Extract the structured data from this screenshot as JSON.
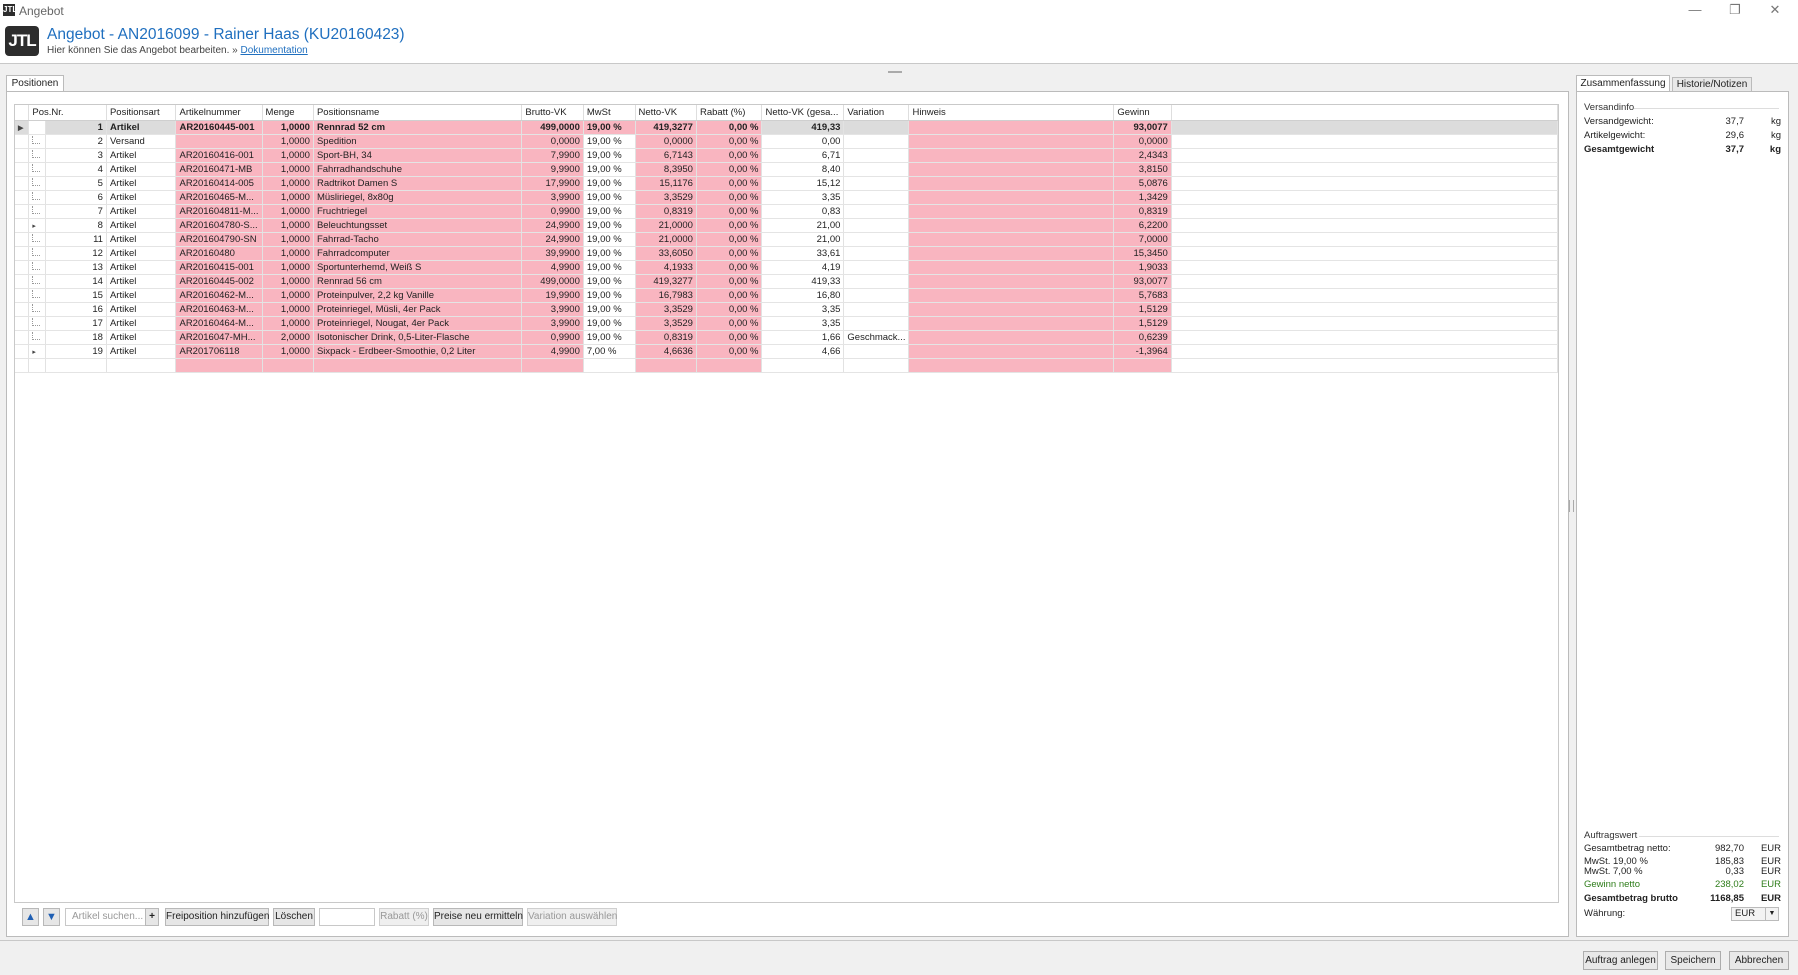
{
  "window": {
    "title": "Angebot",
    "icon": "JTL",
    "minimize": "—",
    "restore": "❐",
    "close": "✕"
  },
  "header": {
    "logo": "JTL",
    "title": "Angebot - AN2016099 - Rainer Haas (KU20160423)",
    "subtitle": "Hier können Sie das Angebot bearbeiten.",
    "separator": "»",
    "doc_link": "Dokumentation"
  },
  "left_tab": "Positionen",
  "columns": [
    "Pos.Nr.",
    "Positionsart",
    "Artikelnummer",
    "Menge",
    "Positionsname",
    "Brutto-VK",
    "MwSt",
    "Netto-VK",
    "Rabatt (%)",
    "Netto-VK (gesa...",
    "Variation",
    "Hinweis",
    "Gewinn"
  ],
  "rows": [
    {
      "pos": "1",
      "art": "Artikel",
      "nr": "AR20160445-001",
      "menge": "1,0000",
      "name": "Rennrad 52 cm",
      "brutto": "499,0000",
      "mwst": "19,00 %",
      "netto": "419,3277",
      "rabatt": "0,00 %",
      "gesamt": "419,33",
      "variation": "",
      "hinweis": "",
      "gewinn": "93,0077",
      "expand": "▸"
    },
    {
      "pos": "2",
      "art": "Versand",
      "nr": "",
      "menge": "1,0000",
      "name": "Spedition",
      "brutto": "0,0000",
      "mwst": "19,00 %",
      "netto": "0,0000",
      "rabatt": "0,00 %",
      "gesamt": "0,00",
      "variation": "",
      "hinweis": "",
      "gewinn": "0,0000",
      "expand": ""
    },
    {
      "pos": "3",
      "art": "Artikel",
      "nr": "AR20160416-001",
      "menge": "1,0000",
      "name": "Sport-BH, 34",
      "brutto": "7,9900",
      "mwst": "19,00 %",
      "netto": "6,7143",
      "rabatt": "0,00 %",
      "gesamt": "6,71",
      "variation": "",
      "hinweis": "",
      "gewinn": "2,4343",
      "expand": ""
    },
    {
      "pos": "4",
      "art": "Artikel",
      "nr": "AR20160471-MB",
      "menge": "1,0000",
      "name": "Fahrradhandschuhe",
      "brutto": "9,9900",
      "mwst": "19,00 %",
      "netto": "8,3950",
      "rabatt": "0,00 %",
      "gesamt": "8,40",
      "variation": "",
      "hinweis": "",
      "gewinn": "3,8150",
      "expand": ""
    },
    {
      "pos": "5",
      "art": "Artikel",
      "nr": "AR20160414-005",
      "menge": "1,0000",
      "name": "Radtrikot Damen S",
      "brutto": "17,9900",
      "mwst": "19,00 %",
      "netto": "15,1176",
      "rabatt": "0,00 %",
      "gesamt": "15,12",
      "variation": "",
      "hinweis": "",
      "gewinn": "5,0876",
      "expand": ""
    },
    {
      "pos": "6",
      "art": "Artikel",
      "nr": "AR20160465-M...",
      "menge": "1,0000",
      "name": "Müsliriegel, 8x80g",
      "brutto": "3,9900",
      "mwst": "19,00 %",
      "netto": "3,3529",
      "rabatt": "0,00 %",
      "gesamt": "3,35",
      "variation": "",
      "hinweis": "",
      "gewinn": "1,3429",
      "expand": ""
    },
    {
      "pos": "7",
      "art": "Artikel",
      "nr": "AR201604811-M...",
      "menge": "1,0000",
      "name": "Fruchtriegel",
      "brutto": "0,9900",
      "mwst": "19,00 %",
      "netto": "0,8319",
      "rabatt": "0,00 %",
      "gesamt": "0,83",
      "variation": "",
      "hinweis": "",
      "gewinn": "0,8319",
      "expand": ""
    },
    {
      "pos": "8",
      "art": "Artikel",
      "nr": "AR201604780-S...",
      "menge": "1,0000",
      "name": "Beleuchtungsset",
      "brutto": "24,9900",
      "mwst": "19,00 %",
      "netto": "21,0000",
      "rabatt": "0,00 %",
      "gesamt": "21,00",
      "variation": "",
      "hinweis": "",
      "gewinn": "6,2200",
      "expand": "▸"
    },
    {
      "pos": "11",
      "art": "Artikel",
      "nr": "AR201604790-SN",
      "menge": "1,0000",
      "name": "Fahrrad-Tacho",
      "brutto": "24,9900",
      "mwst": "19,00 %",
      "netto": "21,0000",
      "rabatt": "0,00 %",
      "gesamt": "21,00",
      "variation": "",
      "hinweis": "",
      "gewinn": "7,0000",
      "expand": ""
    },
    {
      "pos": "12",
      "art": "Artikel",
      "nr": "AR20160480",
      "menge": "1,0000",
      "name": "Fahrradcomputer",
      "brutto": "39,9900",
      "mwst": "19,00 %",
      "netto": "33,6050",
      "rabatt": "0,00 %",
      "gesamt": "33,61",
      "variation": "",
      "hinweis": "",
      "gewinn": "15,3450",
      "expand": ""
    },
    {
      "pos": "13",
      "art": "Artikel",
      "nr": "AR20160415-001",
      "menge": "1,0000",
      "name": "Sportunterhemd, Weiß S",
      "brutto": "4,9900",
      "mwst": "19,00 %",
      "netto": "4,1933",
      "rabatt": "0,00 %",
      "gesamt": "4,19",
      "variation": "",
      "hinweis": "",
      "gewinn": "1,9033",
      "expand": ""
    },
    {
      "pos": "14",
      "art": "Artikel",
      "nr": "AR20160445-002",
      "menge": "1,0000",
      "name": "Rennrad 56 cm",
      "brutto": "499,0000",
      "mwst": "19,00 %",
      "netto": "419,3277",
      "rabatt": "0,00 %",
      "gesamt": "419,33",
      "variation": "",
      "hinweis": "",
      "gewinn": "93,0077",
      "expand": ""
    },
    {
      "pos": "15",
      "art": "Artikel",
      "nr": "AR20160462-M...",
      "menge": "1,0000",
      "name": "Proteinpulver, 2,2 kg Vanille",
      "brutto": "19,9900",
      "mwst": "19,00 %",
      "netto": "16,7983",
      "rabatt": "0,00 %",
      "gesamt": "16,80",
      "variation": "",
      "hinweis": "",
      "gewinn": "5,7683",
      "expand": ""
    },
    {
      "pos": "16",
      "art": "Artikel",
      "nr": "AR20160463-M...",
      "menge": "1,0000",
      "name": "Proteinriegel, Müsli, 4er Pack",
      "brutto": "3,9900",
      "mwst": "19,00 %",
      "netto": "3,3529",
      "rabatt": "0,00 %",
      "gesamt": "3,35",
      "variation": "",
      "hinweis": "",
      "gewinn": "1,5129",
      "expand": ""
    },
    {
      "pos": "17",
      "art": "Artikel",
      "nr": "AR20160464-M...",
      "menge": "1,0000",
      "name": "Proteinriegel, Nougat, 4er Pack",
      "brutto": "3,9900",
      "mwst": "19,00 %",
      "netto": "3,3529",
      "rabatt": "0,00 %",
      "gesamt": "3,35",
      "variation": "",
      "hinweis": "",
      "gewinn": "1,5129",
      "expand": ""
    },
    {
      "pos": "18",
      "art": "Artikel",
      "nr": "AR2016047-MH...",
      "menge": "2,0000",
      "name": "Isotonischer Drink, 0,5-Liter-Flasche",
      "brutto": "0,9900",
      "mwst": "19,00 %",
      "netto": "0,8319",
      "rabatt": "0,00 %",
      "gesamt": "1,66",
      "variation": "Geschmack...",
      "hinweis": "",
      "gewinn": "0,6239",
      "expand": ""
    },
    {
      "pos": "19",
      "art": "Artikel",
      "nr": "AR201706118",
      "menge": "1,0000",
      "name": "Sixpack - Erdbeer-Smoothie, 0,2 Liter",
      "brutto": "4,9900",
      "mwst": "7,00 %",
      "netto": "4,6636",
      "rabatt": "0,00 %",
      "gesamt": "4,66",
      "variation": "",
      "hinweis": "",
      "gewinn": "-1,3964",
      "expand": "▸"
    }
  ],
  "toolbar": {
    "up": "▲",
    "down": "▼",
    "search_placeholder": "Artikel suchen...",
    "add": "+",
    "free_position": "Freiposition hinzufügen",
    "delete": "Löschen",
    "rabatt_placeholder": "Rabatt (%)",
    "recalc": "Preise neu ermitteln",
    "variation": "Variation auswählen"
  },
  "right_tabs": [
    "Zusammenfassung",
    "Historie/Notizen"
  ],
  "versandinfo": {
    "heading": "Versandinfo",
    "rows": [
      {
        "label": "Versandgewicht:",
        "value": "37,7",
        "unit": "kg"
      },
      {
        "label": "Artikelgewicht:",
        "value": "29,6",
        "unit": "kg"
      },
      {
        "label": "Gesamtgewicht",
        "value": "37,7",
        "unit": "kg"
      }
    ]
  },
  "auftragswert": {
    "heading": "Auftragswert",
    "rows": [
      {
        "label": "Gesamtbetrag netto:",
        "value": "982,70",
        "unit": "EUR"
      },
      {
        "label": "MwSt. 19,00 %",
        "value": "185,83",
        "unit": "EUR"
      },
      {
        "label": "MwSt. 7,00 %",
        "value": "0,33",
        "unit": "EUR"
      },
      {
        "label": "Gewinn netto",
        "value": "238,02",
        "unit": "EUR"
      },
      {
        "label": "Gesamtbetrag brutto",
        "value": "1168,85",
        "unit": "EUR"
      }
    ],
    "currency_label": "Währung:",
    "currency": "EUR"
  },
  "footer": {
    "create_order": "Auftrag anlegen",
    "save": "Speichern",
    "cancel": "Abbrechen"
  },
  "colors": {
    "row_pink": "#f9b5c0",
    "title_blue": "#1f6fbf",
    "profit_green": "#2e7d1a"
  }
}
